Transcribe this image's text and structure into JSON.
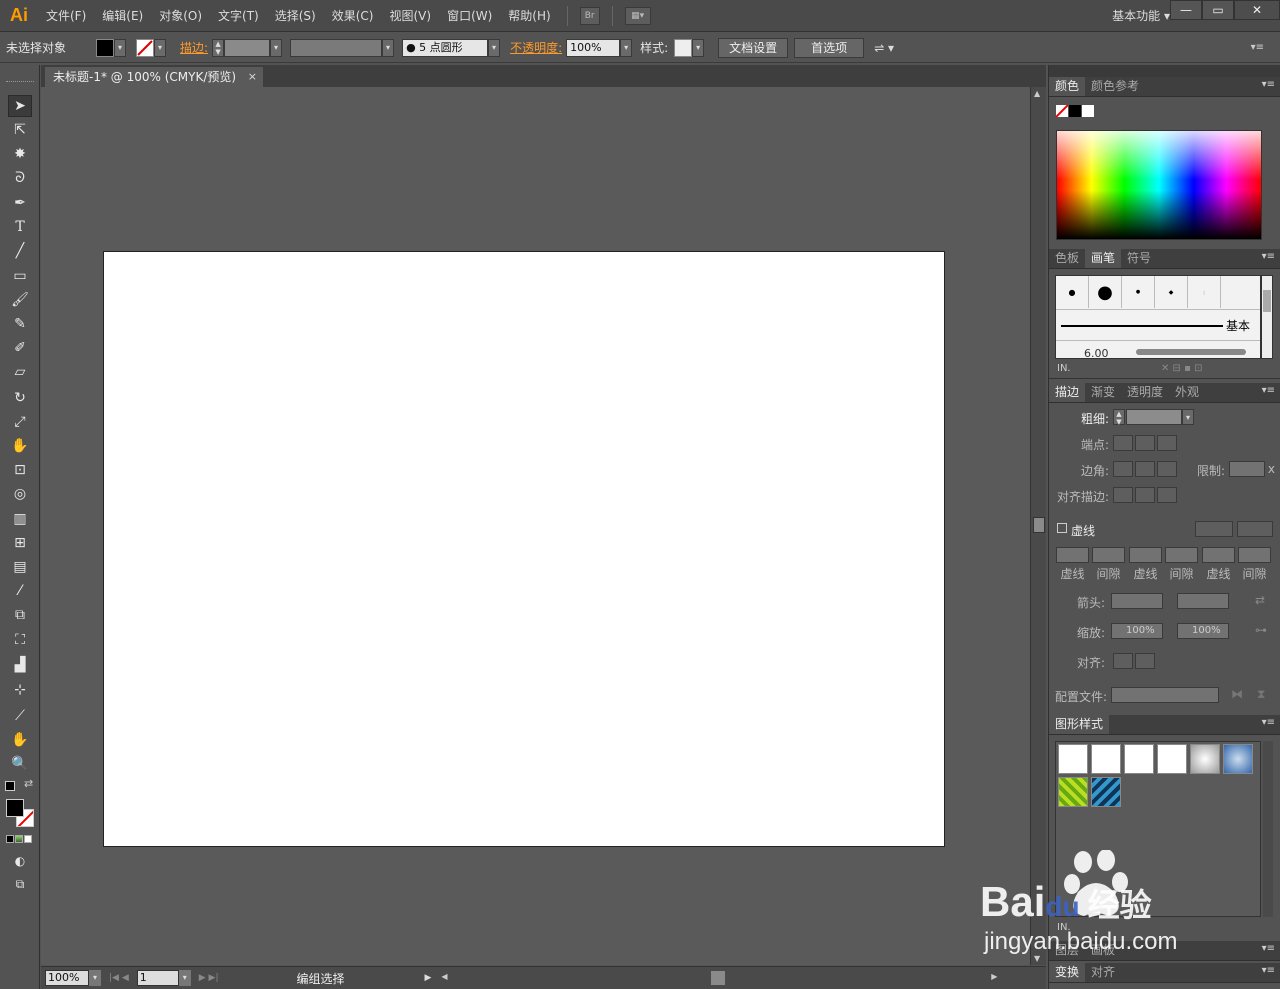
{
  "menubar": {
    "logo": "Ai",
    "items": [
      "文件(F)",
      "编辑(E)",
      "对象(O)",
      "文字(T)",
      "选择(S)",
      "效果(C)",
      "视图(V)",
      "窗口(W)",
      "帮助(H)"
    ],
    "bridge_label": "Br",
    "workspace": "基本功能 ▾",
    "win_min": "—",
    "win_restore": "▭",
    "win_close": "✕"
  },
  "controlbar": {
    "selection_status": "未选择对象",
    "stroke_label": "描边:",
    "brush_label": "5 点圆形",
    "opacity_label": "不透明度:",
    "opacity_value": "100%",
    "style_label": "样式:",
    "doc_setup_button": "文档设置",
    "preferences_button": "首选项"
  },
  "document": {
    "tab_title": "未标题-1* @ 100% (CMYK/预览)",
    "tab_close": "×"
  },
  "statusbar": {
    "zoom": "100%",
    "artboard_number": "1",
    "status_text": "编组选择"
  },
  "panels": {
    "color": {
      "tabs": [
        "颜色",
        "颜色参考"
      ]
    },
    "brushes": {
      "tabs": [
        "色板",
        "画笔",
        "符号"
      ],
      "basic_label": "基本",
      "brush_size": "6.00"
    },
    "stroke": {
      "tabs": [
        "描边",
        "渐变",
        "透明度",
        "外观"
      ],
      "weight_label": "粗细:",
      "cap_label": "端点:",
      "corner_label": "边角:",
      "limit_label": "限制:",
      "limit_x": "x",
      "align_label": "对齐描边:",
      "dashed_label": "虚线",
      "dash_labels": [
        "虚线",
        "间隙",
        "虚线",
        "间隙",
        "虚线",
        "间隙"
      ],
      "arrow_label": "箭头:",
      "scale_label": "缩放:",
      "scale_value_1": "100%",
      "scale_value_2": "100%",
      "align_arrow_label": "对齐:",
      "profile_label": "配置文件:"
    },
    "graphic_styles": {
      "tabs": [
        "图形样式"
      ]
    },
    "bottom": {
      "tabs": [
        "图层",
        "画板"
      ]
    },
    "transform": {
      "tabs": [
        "变换",
        "对齐"
      ]
    }
  },
  "watermark": {
    "brand": "Bai",
    "brand2": "du",
    "brand_cn": "经验",
    "url": "jingyan.baidu.com"
  },
  "colors": {
    "accent_orange": "#ff9a2a",
    "canvas_bg": "#5a5a5a",
    "artboard": "#ffffff"
  }
}
